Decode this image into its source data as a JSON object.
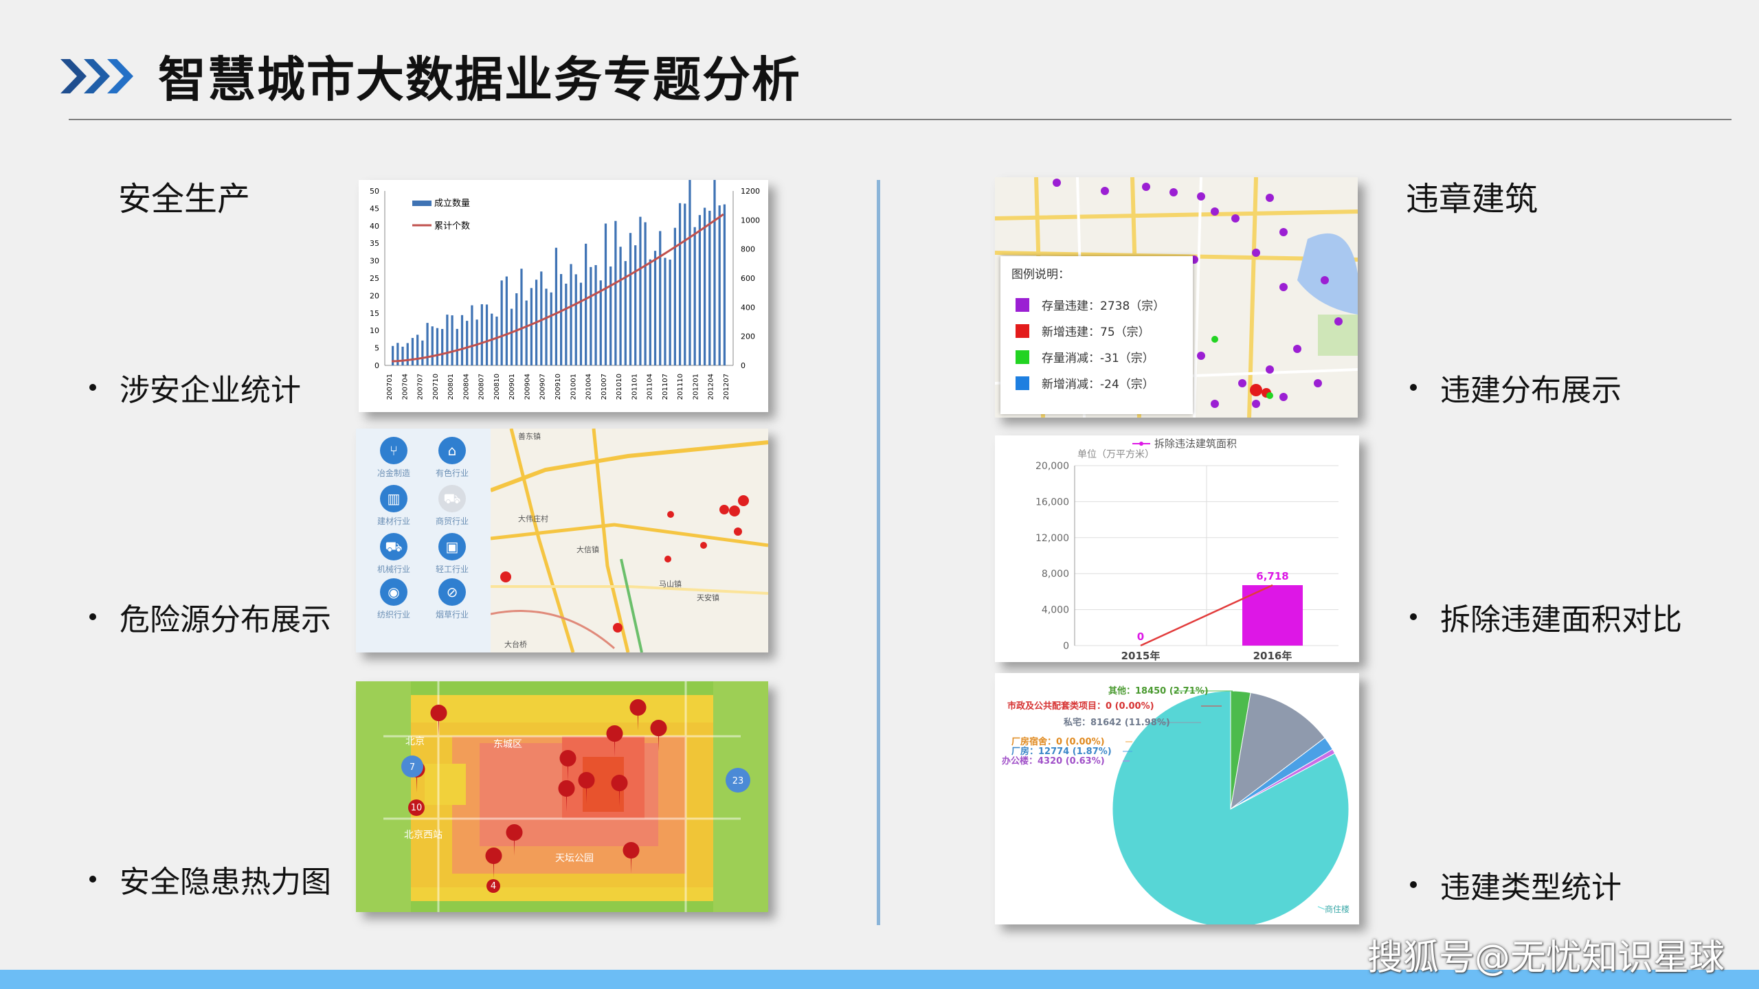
{
  "header": {
    "title": "智慧城市大数据业务专题分析"
  },
  "left": {
    "section_title": "安全生产",
    "bullets": [
      "涉安企业统计",
      "危险源分布展示",
      "安全隐患热力图"
    ],
    "chart": {
      "legend": [
        "成立数量",
        "累计个数"
      ],
      "colors": {
        "bars": "#3f73b4",
        "line": "#c0504d"
      },
      "y_left_ticks": [
        "50",
        "45",
        "40",
        "35",
        "30",
        "25",
        "20",
        "15",
        "10",
        "5",
        "0"
      ],
      "y_right_ticks": [
        "1200",
        "1000",
        "800",
        "600",
        "400",
        "200",
        "0"
      ],
      "x_ticks": [
        "200701",
        "200704",
        "200707",
        "200710",
        "200801",
        "200804",
        "200807",
        "200810",
        "200901",
        "200904",
        "200907",
        "200910",
        "201001",
        "201004",
        "201007",
        "201010",
        "201101",
        "201104",
        "201107",
        "201110",
        "201201",
        "201204",
        "201207"
      ]
    },
    "map_tools": [
      "冶金制造",
      "有色行业",
      "建材行业",
      "商贸行业",
      "机械行业",
      "轻工行业",
      "纺织行业",
      "烟草行业"
    ],
    "map_labels": [
      "善东镇",
      "大伟庄村",
      "大信镇",
      "马山镇",
      "天安镇",
      "大台桥"
    ],
    "heat_labels": [
      "北京",
      "东城区",
      "北京西站",
      "天坛公园"
    ],
    "heat_clusters": [
      "7",
      "10",
      "23",
      "4"
    ]
  },
  "right": {
    "section_title": "违章建筑",
    "bullets": [
      "违建分布展示",
      "拆除违建面积对比",
      "违建类型统计"
    ],
    "map_legend": {
      "title": "图例说明：",
      "items": [
        {
          "label": "存量违建：2738（宗）",
          "color": "#9b1fd3"
        },
        {
          "label": "新增违建：75（宗）",
          "color": "#e31b1b"
        },
        {
          "label": "存量消减：-31（宗）",
          "color": "#22d322"
        },
        {
          "label": "新增消减：-24（宗）",
          "color": "#1e7fe0"
        }
      ]
    },
    "demolition_chart": {
      "legend": "拆除违法建筑面积",
      "unit": "单位（万平方米）",
      "y_ticks": [
        "20,000",
        "16,000",
        "12,000",
        "8,000",
        "4,000",
        "0"
      ],
      "categories": [
        "2015年",
        "2016年"
      ],
      "values": [
        0,
        6718
      ],
      "value_labels": [
        "0",
        "6,718"
      ],
      "colors": {
        "bar": "#dd17e6",
        "line": "#e23b3b"
      }
    },
    "pie_chart": {
      "labels": [
        "其他：18450 (2.71%)",
        "市政及公共配套类项目：0 (0.00%)",
        "私宅：81642 (11.98%)",
        "厂房宿舍：0 (0.00%)",
        "厂房：12774 (1.87%)",
        "办公楼：4320 (0.63%)",
        "商住楼"
      ],
      "colors": [
        "#4cbb4c",
        "#e53b3b",
        "#8f9aad",
        "#f2a23a",
        "#4aa0e6",
        "#c86ee6",
        "#57d6d6"
      ]
    }
  },
  "watermark": "搜狐号@无忧知识星球"
}
